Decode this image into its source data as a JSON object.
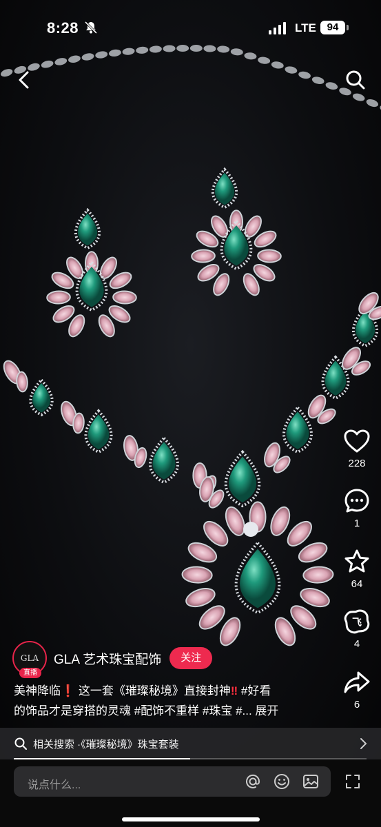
{
  "status_bar": {
    "time": "8:28",
    "network": "LTE",
    "battery": "94"
  },
  "rail": {
    "likes": "228",
    "comments": "1",
    "favorites": "64",
    "shares_pick": "4",
    "shares": "6"
  },
  "author": {
    "name": "GLA 艺术珠宝配饰",
    "avatar_text": "GLA",
    "live_badge": "直播",
    "follow_label": "关注"
  },
  "caption": {
    "p1": "美神降临",
    "p2": " 这一套《璀璨秘境》直接封神",
    "p3": " #好看",
    "p4": "的饰品才是穿搭的灵魂 #配饰不重样 #珠宝 #...",
    "more": " 展开"
  },
  "related": {
    "label": "相关搜索 ·《璀璨秘境》珠宝套装"
  },
  "progress": {
    "fraction": 0.5
  },
  "comment_bar": {
    "placeholder": "说点什么..."
  },
  "colors": {
    "accent": "#ee2a4f",
    "emerald": "#1f9a7c",
    "pink": "#d9a3b3"
  }
}
